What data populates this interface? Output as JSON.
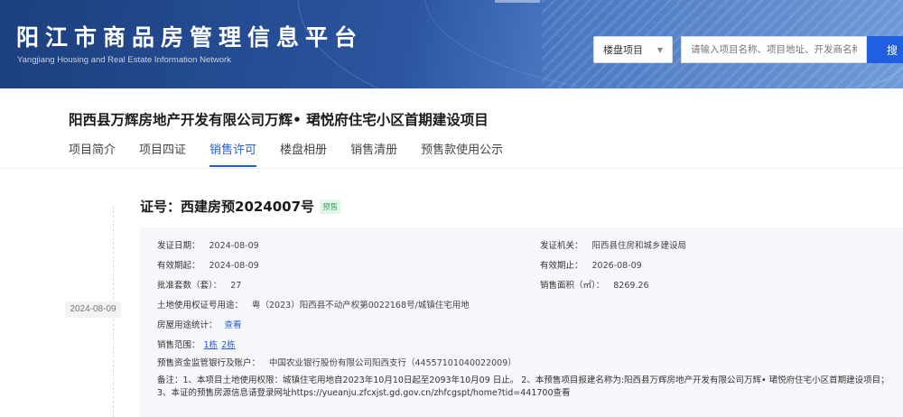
{
  "header": {
    "title": "阳江市商品房管理信息平台",
    "subtitle": "Yangjiang Housing and Real Estate Information Network",
    "search": {
      "select_value": "楼盘项目",
      "placeholder": "请输入项目名称、项目地址、开发商名称",
      "button_label": "搜"
    }
  },
  "project": {
    "title": "阳西县万辉房地产开发有限公司万辉• 珺悦府住宅小区首期建设项目",
    "tabs": [
      {
        "label": "项目简介",
        "active": false
      },
      {
        "label": "项目四证",
        "active": false
      },
      {
        "label": "销售许可",
        "active": true
      },
      {
        "label": "楼盘相册",
        "active": false
      },
      {
        "label": "销售清册",
        "active": false
      },
      {
        "label": "预售款使用公示",
        "active": false
      }
    ]
  },
  "timeline": {
    "date": "2024-08-09"
  },
  "certificate": {
    "title": "证号：西建房预2024007号",
    "badge": "预售",
    "issue_date_label": "发证日期：",
    "issue_date": "2024-08-09",
    "issuer_label": "发证机关：",
    "issuer": "阳西县住房和城乡建设局",
    "valid_from_label": "有效期起：",
    "valid_from": "2024-08-09",
    "valid_to_label": "有效期止：",
    "valid_to": "2026-08-09",
    "approved_units_label": "批准套数（套）：",
    "approved_units": "27",
    "sales_area_label": "销售面积（㎡）：",
    "sales_area": "8269.26",
    "land_cert_label": "土地使用权证号用途：",
    "land_cert": "粤（2023）阳西县不动产权第0022168号/城镇住宅用地",
    "usage_stats_label": "房屋用途统计：",
    "usage_stats_link": "查看",
    "sales_scope_label": "销售范围：",
    "sales_scope_links": [
      "1栋",
      "2栋"
    ],
    "bank_label": "预售资金监管银行及账户：",
    "bank": "中国农业银行股份有限公司阳西支行（44557101040022009）",
    "remark_label": "备注：",
    "remark": "1、本项目土地使用权限：城镇住宅用地自2023年10月10日起至2093年10月09 日止。 2、本预售项目报建名称为:阳西县万辉房地产开发有限公司万辉• 珺悦府住宅小区首期建设项目； 3、本证的预售房源信息请登录网址https://yueanju.zfcxjst.gd.gov.cn/zhfcgspt/home?tid=441700查看"
  }
}
